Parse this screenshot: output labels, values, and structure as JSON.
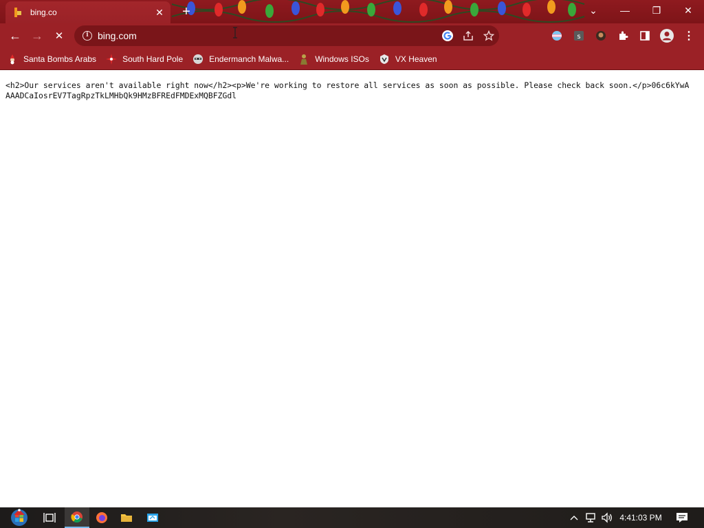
{
  "tab": {
    "title": "bing.co",
    "close_glyph": "✕",
    "new_tab_glyph": "+"
  },
  "window_controls": {
    "tab_search": "⌄",
    "minimize": "—",
    "restore": "❐",
    "close": "✕"
  },
  "toolbar": {
    "back": "←",
    "forward": "→",
    "stop": "✕"
  },
  "omnibox": {
    "url": "bing.com"
  },
  "bookmarks": [
    {
      "label": "Santa Bombs Arabs",
      "icon": "santa-icon"
    },
    {
      "label": "South Hard Pole",
      "icon": "star-burst-icon"
    },
    {
      "label": "Endermanch Malwa...",
      "icon": "raccoon-icon"
    },
    {
      "label": "Windows ISOs",
      "icon": "figure-icon"
    },
    {
      "label": "VX Heaven",
      "icon": "shield-icon"
    }
  ],
  "page": {
    "raw_text": "<h2>Our services aren't available right now</h2><p>We're working to restore all services as soon as possible. Please check back soon.</p>06c6kYwAAAADCaIosrEV7TagRpzTkLMHbQk9HMzBFREdFMDExMQBFZGdl"
  },
  "taskbar": {
    "time": "4:41:03 PM"
  },
  "colors": {
    "frame": "#9b2126",
    "tabstrip": "#8f1a1f",
    "omnibox": "#7a1519"
  }
}
